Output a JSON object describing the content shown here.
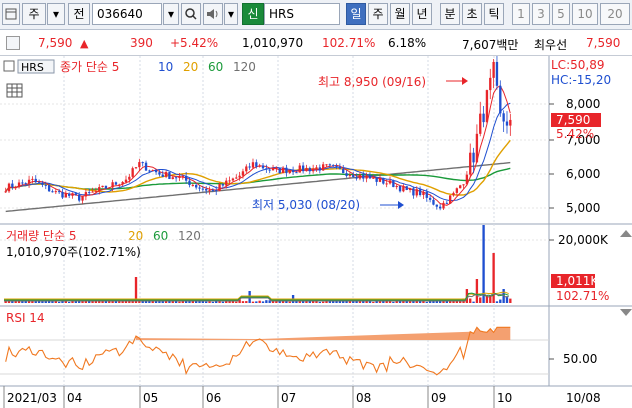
{
  "toolbar": {
    "menu_label": "주",
    "tab_jeon": "전",
    "stock_code": "036640",
    "new_label": "신",
    "stock_name": "HRS",
    "periods": [
      "일",
      "주",
      "월",
      "년",
      "분",
      "초",
      "틱"
    ],
    "selected_period": "일",
    "numbers": [
      "1",
      "3",
      "5",
      "10",
      "20"
    ]
  },
  "quote": {
    "price": "7,590",
    "change": "390",
    "change_pct": "+5.42%",
    "volume": "1,010,970",
    "volume_ratio": "102.71%",
    "turnover": "6.18%",
    "amount": "7,607백만",
    "best_label": "최우선",
    "best_price": "7,590"
  },
  "colors": {
    "up": "#e8252a",
    "down": "#1f4fd0",
    "ma5": "#e8252a",
    "ma10": "#1f4fd0",
    "ma20": "#e0a000",
    "ma60": "#1a9a3a",
    "ma120": "#707070"
  },
  "price_pane": {
    "legend_name": "HRS",
    "legend_title": "종가 단순 5",
    "legend_ma": [
      "10",
      "20",
      "60",
      "120"
    ],
    "high_label": "최고 8,950 (09/16)",
    "low_label": "최저 5,030 (08/20)",
    "lc": "LC:50,89",
    "hc": "HC:-15,20",
    "y_ticks": [
      "8,000",
      "7,000",
      "6,000",
      "5,000"
    ],
    "last_price": "7,590",
    "last_pct": "5.42%"
  },
  "volume_pane": {
    "legend_title": "거래량 단순 5",
    "legend_ma": [
      "20",
      "60",
      "120"
    ],
    "info": "1,010,970주(102.71%)",
    "y_tick": "20,000K",
    "last_value": "1,011K",
    "last_pct": "102.71%"
  },
  "rsi_pane": {
    "legend": "RSI 14",
    "y_tick": "50.00"
  },
  "x_axis": {
    "labels": [
      "2021/03",
      "04",
      "05",
      "06",
      "07",
      "08",
      "09",
      "10"
    ],
    "right_label": "10/08"
  },
  "icons": [
    "dropdown-icon",
    "search-icon",
    "speaker-icon",
    "chart-type-icon",
    "table-icon",
    "left-arrow-icon",
    "settings-icon"
  ]
}
